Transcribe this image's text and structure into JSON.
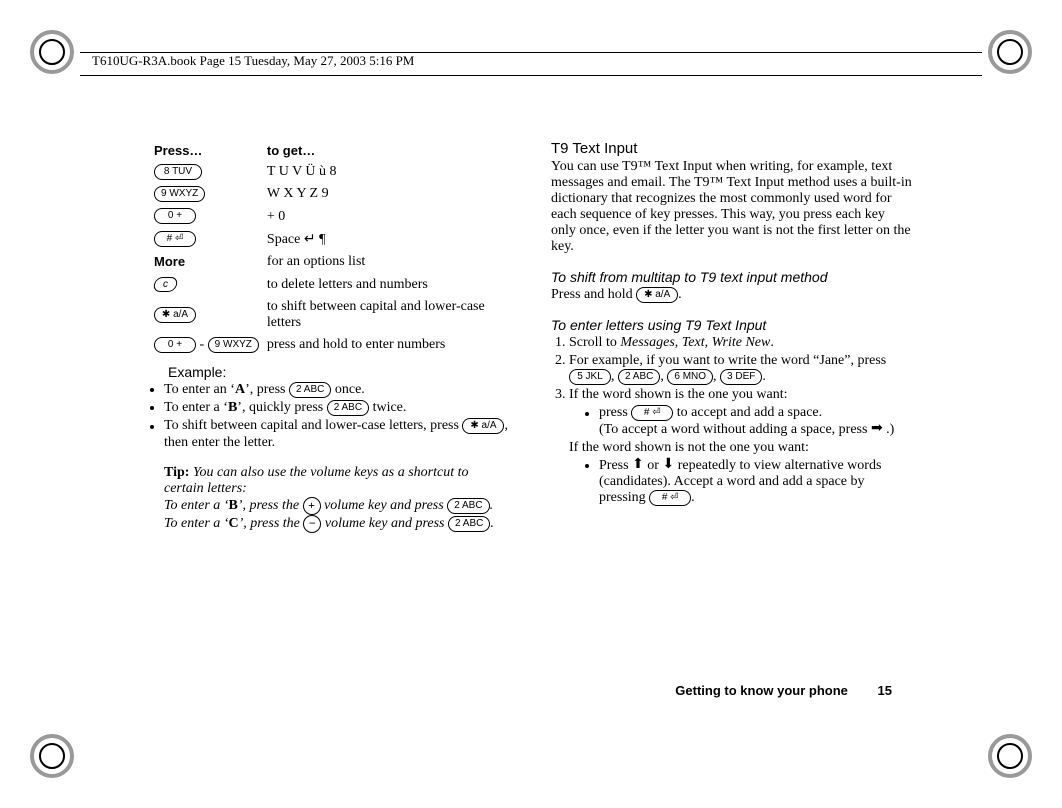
{
  "header": {
    "label": "T610UG-R3A.book  Page 15  Tuesday, May 27, 2003  5:16 PM"
  },
  "table": {
    "head_press": "Press…",
    "head_get": "to get…",
    "rows": [
      {
        "key_label": "8 TUV",
        "value": "T U V Ü ù 8"
      },
      {
        "key_label": "9 WXYZ",
        "value": "W X Y Z 9"
      },
      {
        "key_label": "0 +",
        "value": "+ 0"
      },
      {
        "key_label": "# ⏎",
        "value": "Space ↵ ¶"
      },
      {
        "key_label": "More",
        "value": "for an options list",
        "is_more": true
      },
      {
        "key_label": "c",
        "value": "to delete letters and numbers",
        "is_c": true
      },
      {
        "key_label": "✱ a/A",
        "value": "to shift between capital and lower-case letters"
      },
      {
        "key_label_range_a": "0 +",
        "key_label_range_sep": "-",
        "key_label_range_b": "9 WXYZ",
        "value": "press and hold to enter numbers",
        "is_range": true
      }
    ]
  },
  "example": {
    "heading": "Example:",
    "b1_pre": "To enter an ‘",
    "b1_letter": "A",
    "b1_mid": "’, press ",
    "b1_key": "2 ABC",
    "b1_post": " once.",
    "b2_pre": "To enter a ‘",
    "b2_letter": "B",
    "b2_mid": "’, quickly press ",
    "b2_key": "2 ABC",
    "b2_post": " twice.",
    "b3_pre": "To shift between capital and lower-case letters, press ",
    "b3_key": "✱ a/A",
    "b3_post": ", then enter the letter."
  },
  "tip": {
    "label": "Tip:",
    "line1": " You can also use the volume keys as a shortcut to certain letters:",
    "line2_pre": "To enter a ‘",
    "line2_letter": "B",
    "line2_mid": "’, press the ",
    "line2_after": " volume key and press ",
    "line2_key": "2 ABC",
    "line2_end": ".",
    "line3_pre": "To enter a ‘",
    "line3_letter": "C",
    "line3_mid": "’, press the ",
    "line3_after": " volume key and press ",
    "line3_key": "2 ABC",
    "line3_end": "."
  },
  "right": {
    "h2": "T9 Text Input",
    "p1": "You can use T9™ Text Input when writing, for example, text messages and email. The T9™ Text Input method uses a built-in dictionary that recognizes the most commonly used word for each sequence of key presses. This way, you press each key only once, even if the letter you want is not the first letter on the key.",
    "h3a": "To shift from multitap to T9 text input method",
    "h3a_line_pre": "Press and hold ",
    "h3a_key": "✱ a/A",
    "h3a_line_post": ".",
    "h3b": "To enter letters using T9 Text Input",
    "steps": {
      "s1_pre": "Scroll to ",
      "s1_i1": "Messages",
      "s1_c1": ", ",
      "s1_i2": "Text",
      "s1_c2": ", ",
      "s1_i3": "Write New",
      "s1_end": ".",
      "s2_pre": "For example, if you want to write the word “Jane”, press ",
      "s2_k1": "5 JKL",
      "s2_k2": "2 ABC",
      "s2_k3": "6 MNO",
      "s2_k4": "3 DEF",
      "s2_end": ".",
      "s3": "If the word shown is the one you want:",
      "s3_b1_pre": "press ",
      "s3_b1_key": "# ⏎",
      "s3_b1_post": " to accept and add a space.",
      "s3_b1_note_pre": "(To accept a word without adding a space, press ",
      "s3_b1_note_post": " .)",
      "s3_alt": "If the word shown is not the one you want:",
      "s3_b2_pre": "Press ",
      "s3_b2_mid": " or ",
      "s3_b2_post1": " repeatedly to view alternative words (candidates). Accept a word and add a space by pressing ",
      "s3_b2_key": "# ⏎",
      "s3_b2_end": "."
    }
  },
  "footer": {
    "section": "Getting to know your phone",
    "page": "15"
  }
}
